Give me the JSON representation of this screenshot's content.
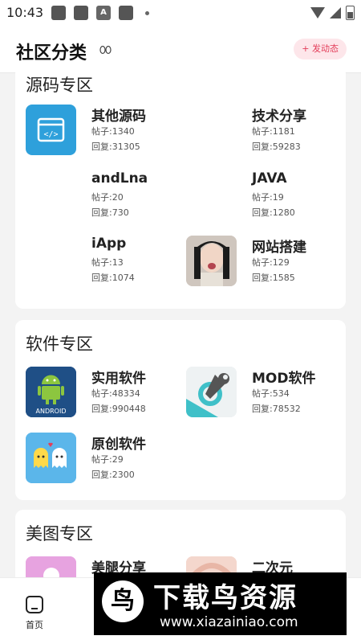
{
  "status_bar": {
    "time": "10:43",
    "a_badge": "A"
  },
  "header": {
    "title": "社区分类",
    "post_button": "+ 发动态"
  },
  "sections": [
    {
      "title": "源码专区",
      "items": [
        {
          "name": "其他源码",
          "posts": "帖子:1340",
          "replies": "回复:31305",
          "icon": "code-window-icon"
        },
        {
          "name": "技术分享",
          "posts": "帖子:1181",
          "replies": "回复:59283",
          "icon": "none"
        },
        {
          "name": "andLna",
          "posts": "帖子:20",
          "replies": "回复:730",
          "icon": "none"
        },
        {
          "name": "JAVA",
          "posts": "帖子:19",
          "replies": "回复:1280",
          "icon": "none"
        },
        {
          "name": "iApp",
          "posts": "帖子:13",
          "replies": "回复:1074",
          "icon": "none"
        },
        {
          "name": "网站搭建",
          "posts": "帖子:129",
          "replies": "回复:1585",
          "icon": "photo-icon"
        }
      ]
    },
    {
      "title": "软件专区",
      "items": [
        {
          "name": "实用软件",
          "posts": "帖子:48334",
          "replies": "回复:990448",
          "icon": "android-icon"
        },
        {
          "name": "MOD软件",
          "posts": "帖子:534",
          "replies": "回复:78532",
          "icon": "wrench-gear-icon"
        },
        {
          "name": "原创软件",
          "posts": "帖子:29",
          "replies": "回复:2300",
          "icon": "ghost-icon"
        }
      ]
    },
    {
      "title": "美图专区",
      "items": [
        {
          "name": "美腿分享",
          "icon": "pink-icon"
        },
        {
          "name": "二次元",
          "icon": "anime-icon"
        }
      ]
    }
  ],
  "bottom_nav": {
    "home_label": "首页"
  },
  "watermark": {
    "logo": "鸟",
    "title": "下载鸟资源",
    "url": "www.xiazainiao.com"
  },
  "colors": {
    "accent": "#e33e5a",
    "accent_bg": "#fde6ea",
    "blue_icon": "#2ea0db"
  }
}
